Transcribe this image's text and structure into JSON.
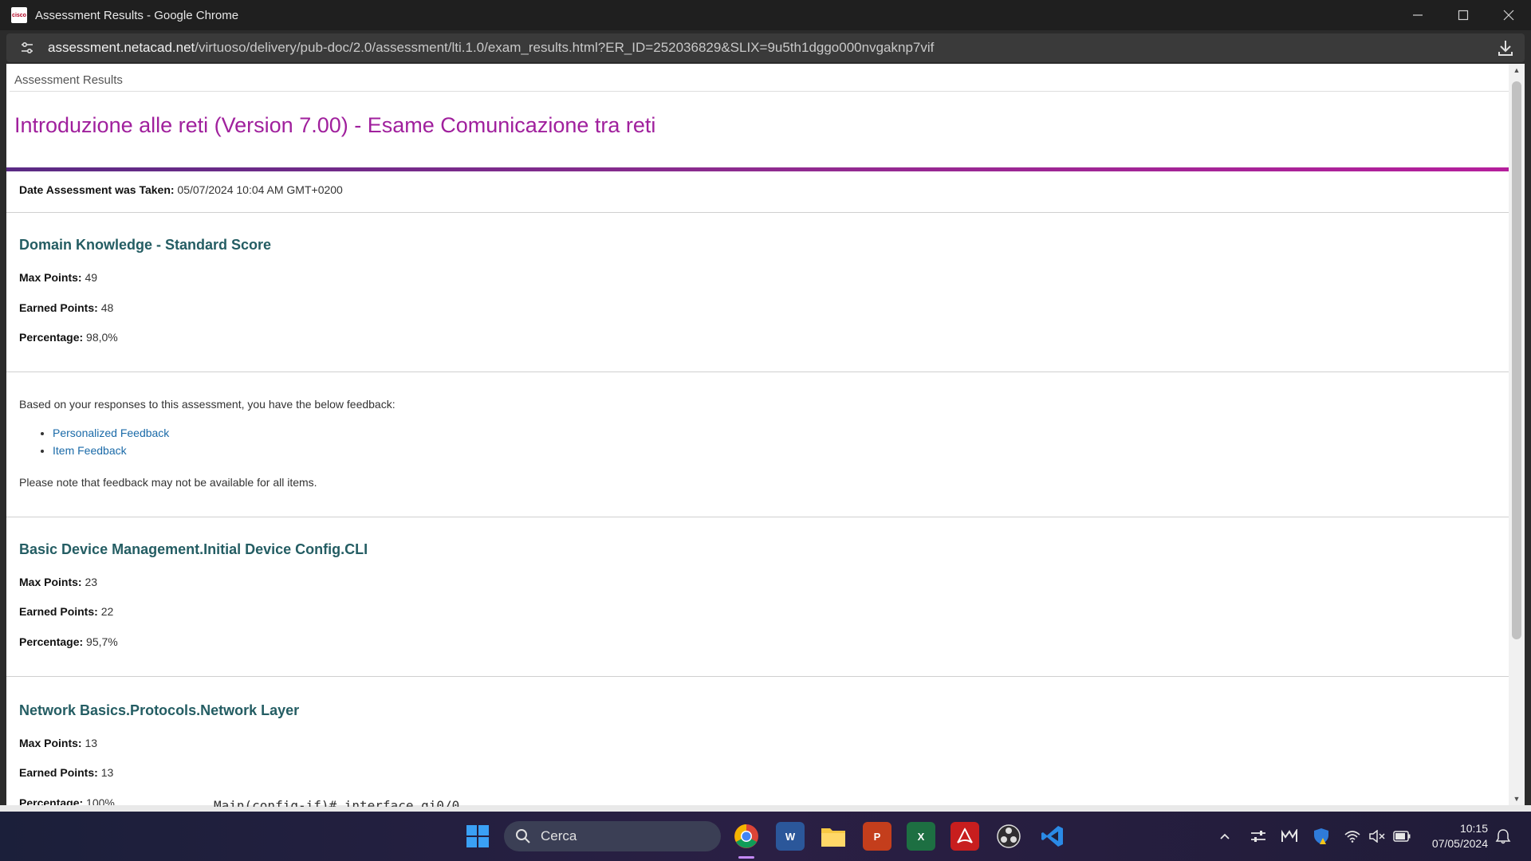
{
  "window": {
    "title": "Assessment Results - Google Chrome",
    "favicon_text": "cisco"
  },
  "address_bar": {
    "host": "assessment.netacad.net",
    "path": "/virtuoso/delivery/pub-doc/2.0/assessment/lti.1.0/exam_results.html?ER_ID=252036829&SLIX=9u5th1dggo000nvgaknp7vif"
  },
  "page": {
    "breadcrumb": "Assessment Results",
    "exam_title": "Introduzione alle reti (Version 7.00) - Esame Comunicazione tra reti",
    "date_label": "Date Assessment was Taken:",
    "date_value": "05/07/2024 10:04 AM GMT+0200",
    "domain": {
      "heading": "Domain Knowledge - Standard Score",
      "max_label": "Max Points:",
      "max_value": "49",
      "earned_label": "Earned Points:",
      "earned_value": "48",
      "pct_label": "Percentage:",
      "pct_value": "98,0%"
    },
    "feedback": {
      "intro": "Based on your responses to this assessment, you have the below feedback:",
      "link1": "Personalized Feedback",
      "link2": "Item Feedback",
      "note": "Please note that feedback may not be available for all items."
    },
    "basic_device": {
      "heading": "Basic Device Management.Initial Device Config.CLI",
      "max_label": "Max Points:",
      "max_value": "23",
      "earned_label": "Earned Points:",
      "earned_value": "22",
      "pct_label": "Percentage:",
      "pct_value": "95,7%"
    },
    "network_basics": {
      "heading": "Network Basics.Protocols.Network Layer",
      "max_label": "Max Points:",
      "max_value": "13",
      "earned_label": "Earned Points:",
      "earned_value": "13",
      "pct_label": "Percentage:",
      "pct_value": "100%"
    },
    "terminal_peek": "Main(config-if)# interface gi0/0"
  },
  "taskbar": {
    "search_label": "Cerca",
    "word_letter": "W",
    "powerpoint_letter": "P",
    "excel_letter": "X",
    "time": "10:15",
    "date": "07/05/2024"
  }
}
